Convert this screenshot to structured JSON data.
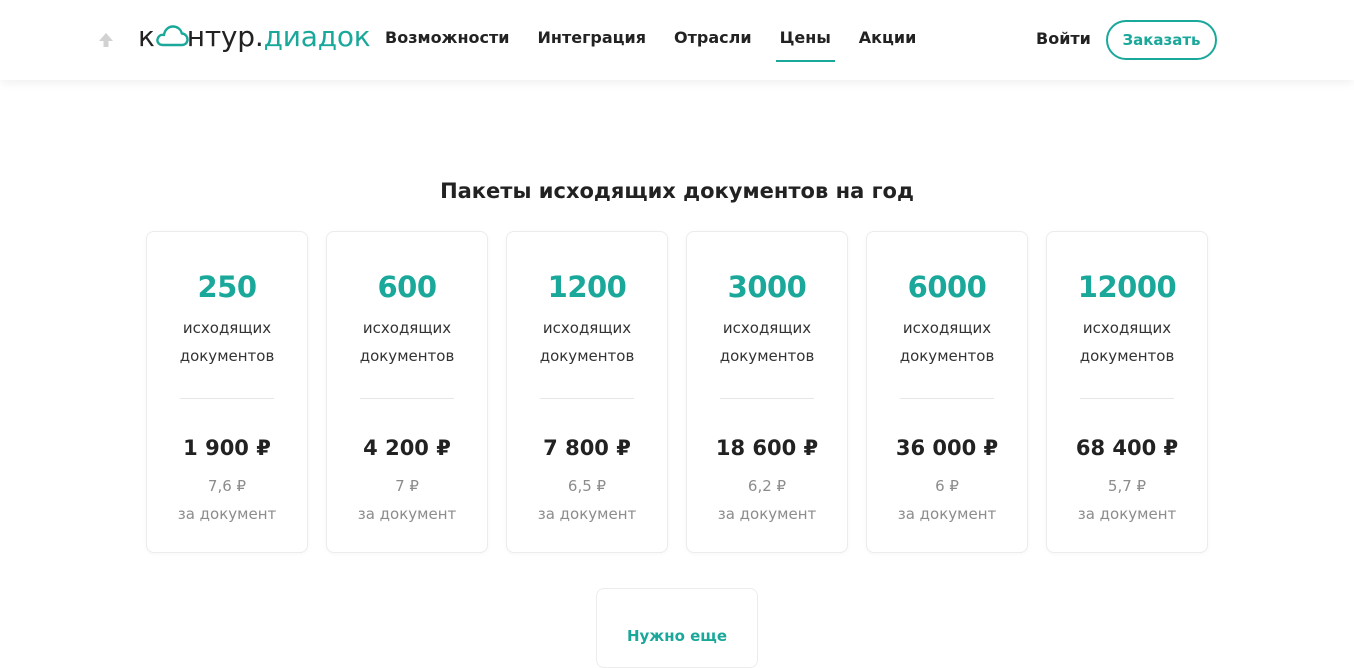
{
  "header": {
    "logo": {
      "part1": "к",
      "part2": "нтур.",
      "part3": "диадок"
    },
    "nav": [
      "Возможности",
      "Интеграция",
      "Отрасли",
      "Цены",
      "Акции"
    ],
    "active_nav": "Цены",
    "login_label": "Войти",
    "order_label": "Заказать"
  },
  "colors": {
    "accent": "#1aa89a",
    "text": "#222222",
    "muted": "#8c8c8c"
  },
  "section": {
    "title": "Пакеты исходящих документов на год",
    "desc_line1": "исходящих",
    "desc_line2": "документов",
    "per_doc_label": "за документ",
    "packages": [
      {
        "count": "250",
        "price": "1 900 ₽",
        "per_doc": "7,6 ₽"
      },
      {
        "count": "600",
        "price": "4 200 ₽",
        "per_doc": "7 ₽"
      },
      {
        "count": "1200",
        "price": "7 800 ₽",
        "per_doc": "6,5 ₽"
      },
      {
        "count": "3000",
        "price": "18 600 ₽",
        "per_doc": "6,2 ₽"
      },
      {
        "count": "6000",
        "price": "36 000 ₽",
        "per_doc": "6 ₽"
      },
      {
        "count": "12000",
        "price": "68 400 ₽",
        "per_doc": "5,7 ₽"
      }
    ],
    "more_label": "Нужно еще"
  },
  "icons": {
    "scroll_top": "arrow-up-icon",
    "logo_mark": "cloud-icon"
  }
}
